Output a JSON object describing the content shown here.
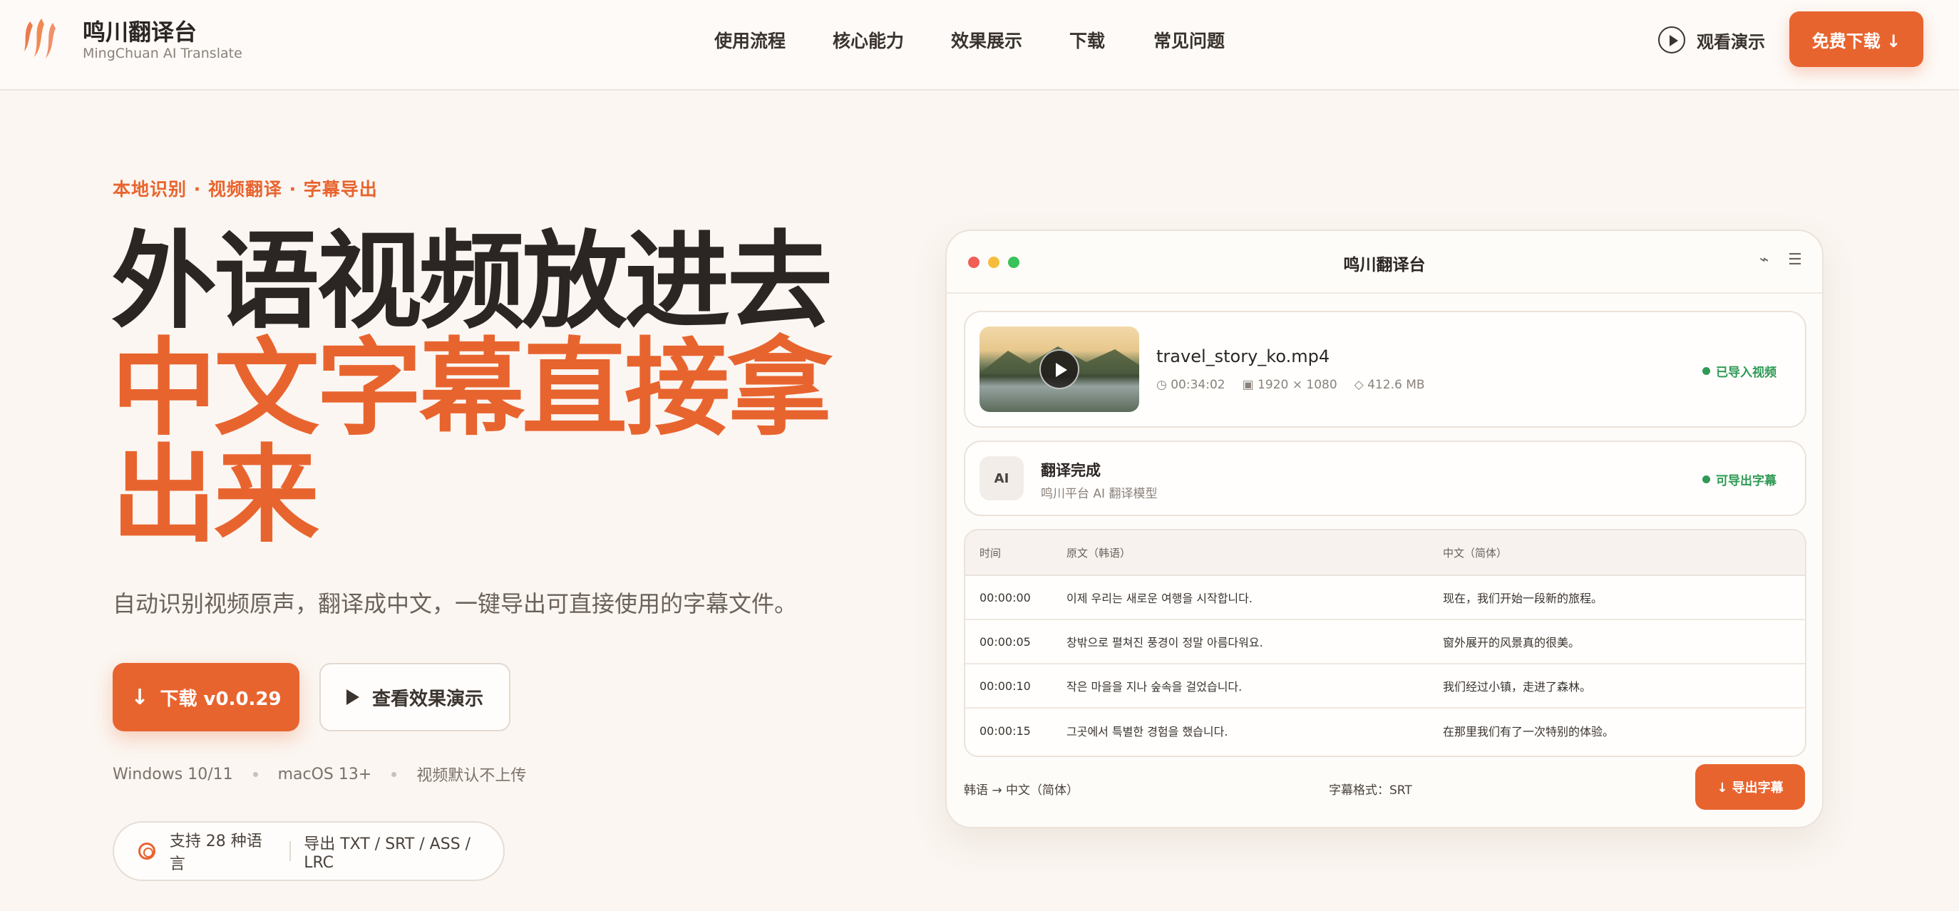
{
  "header": {
    "brand_name": "鸣川翻译台",
    "brand_sub": "MingChuan AI Translate",
    "nav": [
      "使用流程",
      "核心能力",
      "效果展示",
      "下载",
      "常见问题"
    ],
    "watch_demo": "观看演示",
    "free_download": "免费下载 ↓"
  },
  "hero": {
    "eyebrow": "本地识别 · 视频翻译 · 字幕导出",
    "title_line1": "外语视频放进去",
    "title_line2": "中文字幕直接拿出来",
    "lead": "自动识别视频原声，翻译成中文，一键导出可直接使用的字幕文件。",
    "download_arrow": "↓",
    "download_label": "下载 v0.0.29",
    "demo_label": "查看效果演示",
    "platforms": [
      "Windows 10/11",
      "macOS 13+",
      "视频默认不上传"
    ],
    "pill_languages": "支持 28 种语言",
    "pill_formats": "导出 TXT / SRT / ASS / LRC"
  },
  "app": {
    "title": "鸣川翻译台",
    "icon_link": "⌁",
    "icon_menu": "☰",
    "video": {
      "filename": "travel_story_ko.mp4",
      "duration": "◷ 00:34:02",
      "resolution": "▣ 1920 × 1080",
      "size": "◇ 412.6 MB",
      "status": "已导入视频"
    },
    "ai": {
      "badge": "AI",
      "title": "翻译完成",
      "sub": "鸣川平台 AI 翻译模型",
      "status": "可导出字幕"
    },
    "table": {
      "headers": [
        "时间",
        "原文（韩语）",
        "中文（简体）"
      ],
      "rows": [
        {
          "time": "00:00:00",
          "src": "이제 우리는 새로운 여행을 시작합니다.",
          "zh": "现在，我们开始一段新的旅程。"
        },
        {
          "time": "00:00:05",
          "src": "창밖으로 펼쳐진 풍경이 정말 아름다워요.",
          "zh": "窗外展开的风景真的很美。"
        },
        {
          "time": "00:00:10",
          "src": "작은 마을을 지나 숲속을 걸었습니다.",
          "zh": "我们经过小镇，走进了森林。"
        },
        {
          "time": "00:00:15",
          "src": "그곳에서 특별한 경험을 했습니다.",
          "zh": "在那里我们有了一次特别的体验。"
        }
      ]
    },
    "footer": {
      "lang_pair": "韩语 → 中文（简体）",
      "format": "字幕格式：SRT",
      "export": "↓ 导出字幕"
    }
  },
  "colors": {
    "accent": "#e8642f",
    "success": "#2f9a55",
    "background": "#fbf6f1",
    "text": "#2b2623"
  }
}
